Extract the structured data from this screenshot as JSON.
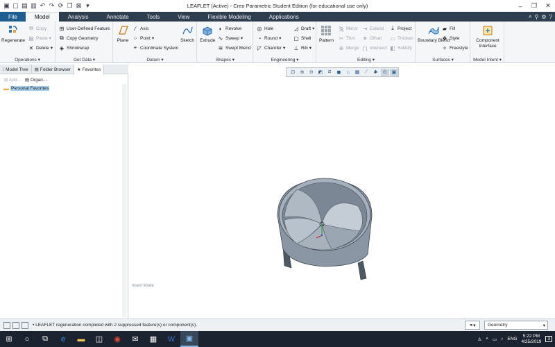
{
  "window": {
    "title": "LEAFLET (Active) - Creo Parametric Student Edition (for educational use only)"
  },
  "tabs": [
    {
      "label": "File"
    },
    {
      "label": "Model"
    },
    {
      "label": "Analysis"
    },
    {
      "label": "Annotate"
    },
    {
      "label": "Tools"
    },
    {
      "label": "View"
    },
    {
      "label": "Flexible Modeling"
    },
    {
      "label": "Applications"
    }
  ],
  "ribbon": {
    "operations": {
      "group": "Operations",
      "regenerate": "Regenerate",
      "copy": "Copy",
      "paste": "Paste",
      "delete": "Delete"
    },
    "getdata": {
      "group": "Get Data",
      "udf": "User-Defined Feature",
      "copygeom": "Copy Geometry",
      "shrinkwrap": "Shrinkwrap"
    },
    "datum": {
      "group": "Datum",
      "plane": "Plane",
      "axis": "Axis",
      "point": "Point",
      "csys": "Coordinate System",
      "sketch": "Sketch"
    },
    "shapes": {
      "group": "Shapes",
      "extrude": "Extrude",
      "revolve": "Revolve",
      "sweep": "Sweep",
      "sweptblend": "Swept Blend"
    },
    "engineering": {
      "group": "Engineering",
      "hole": "Hole",
      "round": "Round",
      "chamfer": "Chamfer",
      "draft": "Draft",
      "shell": "Shell",
      "rib": "Rib"
    },
    "editing": {
      "group": "Editing",
      "pattern": "Pattern",
      "mirror": "Mirror",
      "trim": "Trim",
      "merge": "Merge",
      "extend": "Extend",
      "offset": "Offset",
      "intersect": "Intersect",
      "project": "Project",
      "thicken": "Thicken",
      "solidify": "Solidify"
    },
    "surfaces": {
      "group": "Surfaces",
      "boundary": "Boundary Blend",
      "fill": "Fill",
      "style": "Style",
      "freestyle": "Freestyle"
    },
    "modelintent": {
      "group": "Model Intent",
      "component": "Component Interface"
    }
  },
  "navigator": {
    "tabs": [
      "Model Tree",
      "Folder Browser",
      "Favorites"
    ],
    "add": "Add...",
    "organize": "Organ...",
    "favorite": "Personal Favorites"
  },
  "canvas": {
    "mode_text": "Insert Mode"
  },
  "status": {
    "message": "• LEAFLET regeneration completed with 2 suppressed feature(s) or component(s).",
    "filter_value": "Geometry"
  },
  "taskbar": {
    "lang": "ENG",
    "time": "5:22 PM",
    "date": "4/25/2019",
    "notif": "3"
  },
  "colors": {
    "tab_bg": "#2f3e4e",
    "file_tab": "#1e5d8f",
    "model_fill": "#9aa6b2"
  }
}
